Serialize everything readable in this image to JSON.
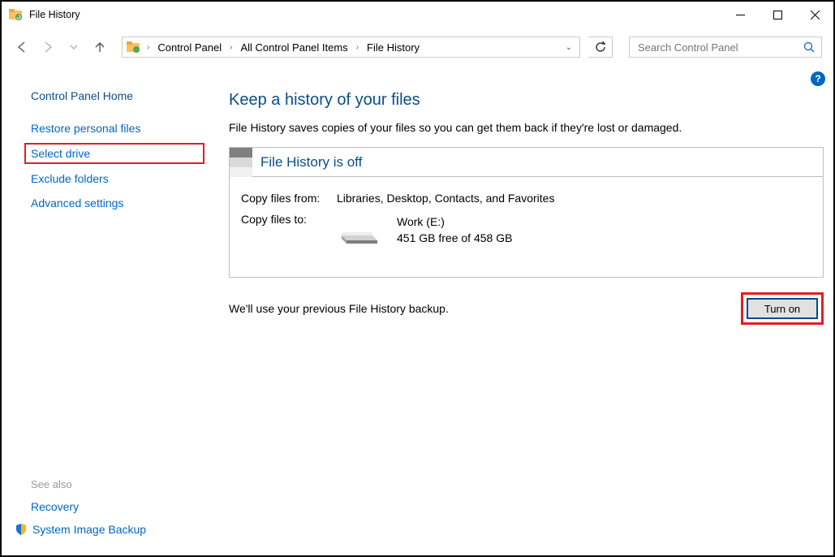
{
  "window": {
    "title": "File History"
  },
  "breadcrumbs": {
    "a": "Control Panel",
    "b": "All Control Panel Items",
    "c": "File History"
  },
  "search": {
    "placeholder": "Search Control Panel"
  },
  "sidebar": {
    "home": "Control Panel Home",
    "restore": "Restore personal files",
    "select_drive": "Select drive",
    "exclude": "Exclude folders",
    "advanced": "Advanced settings",
    "see_also": "See also",
    "recovery": "Recovery",
    "sib": "System Image Backup"
  },
  "main": {
    "heading": "Keep a history of your files",
    "desc": "File History saves copies of your files so you can get them back if they're lost or damaged.",
    "status_title": "File History is off",
    "copy_from_label": "Copy files from:",
    "copy_from_value": "Libraries, Desktop, Contacts, and Favorites",
    "copy_to_label": "Copy files to:",
    "drive_name": "Work (E:)",
    "drive_space": "451 GB free of 458 GB",
    "prev_msg": "We'll use your previous File History backup.",
    "turn_on": "Turn on"
  },
  "help": "?"
}
